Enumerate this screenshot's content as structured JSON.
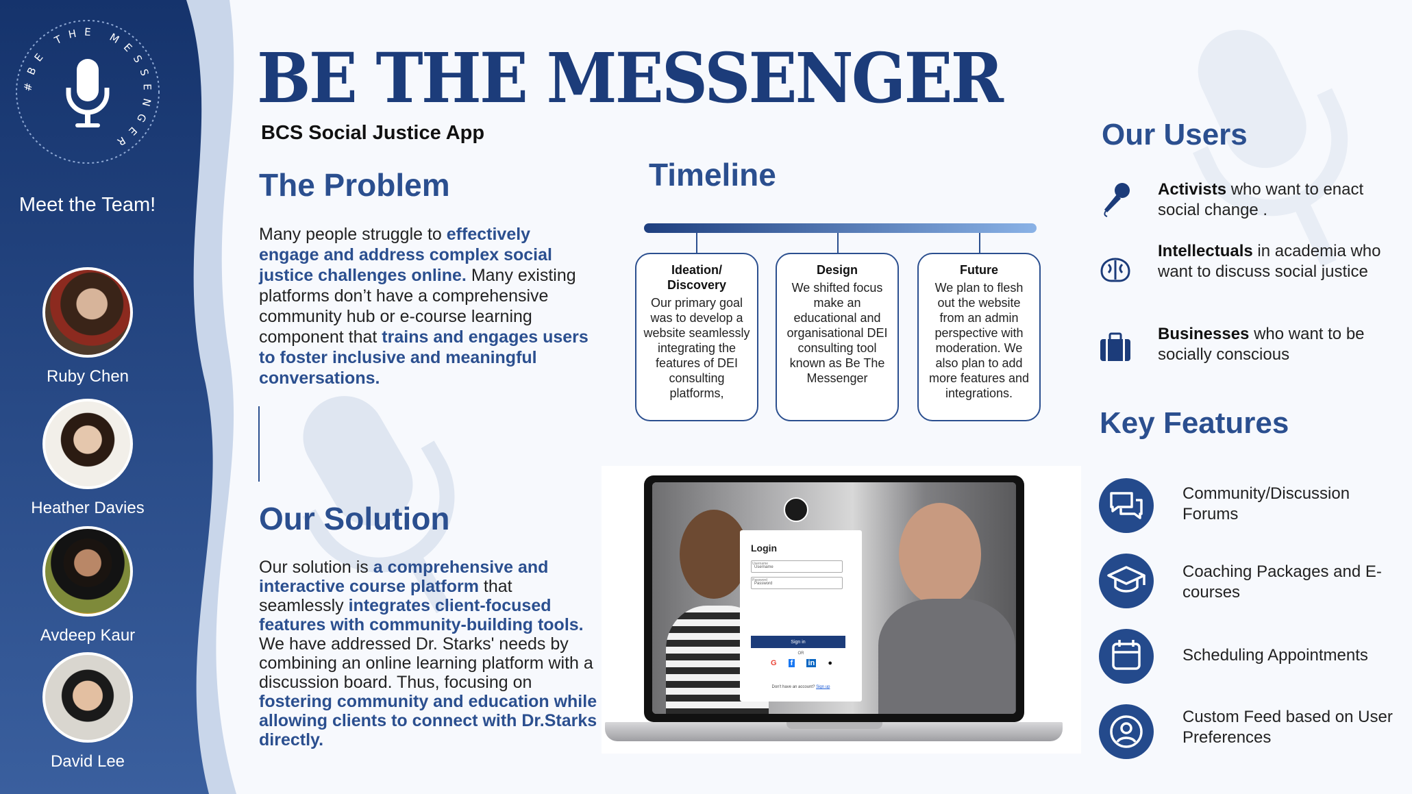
{
  "logo": {
    "ring_text": "#BE THE MESSENGER"
  },
  "team": {
    "heading": "Meet the Team!",
    "members": [
      {
        "name": "Ruby Chen"
      },
      {
        "name": "Heather Davies"
      },
      {
        "name": "Avdeep Kaur"
      },
      {
        "name": "David Lee"
      }
    ]
  },
  "header": {
    "title": "BE THE MESSENGER",
    "subtitle": "BCS Social Justice App"
  },
  "problem": {
    "heading": "The Problem",
    "parts": [
      "Many people struggle to ",
      "effectively engage and address complex social justice challenges online.",
      " Many existing platforms don’t have a comprehensive community hub or e-course learning component that ",
      "trains and engages users to foster inclusive and meaningful conversations."
    ]
  },
  "solution": {
    "heading": "Our Solution",
    "parts": [
      "Our solution is ",
      "a comprehensive and interactive course platform",
      " that seamlessly ",
      "integrates client-focused features with community-building tools.",
      " We have addressed Dr. Starks' needs by combining an online learning platform with a discussion board. Thus, focusing on ",
      "fostering community and education while allowing clients to connect with Dr.Starks directly."
    ]
  },
  "timeline": {
    "heading": "Timeline",
    "stages": [
      {
        "title": "Ideation/ Discovery",
        "text": "Our primary goal was to develop a website seamlessly integrating the features of DEI consulting platforms,"
      },
      {
        "title": "Design",
        "text": "We shifted focus make an educational and organisational DEI consulting tool known as Be The Messenger"
      },
      {
        "title": "Future",
        "text": "We plan to flesh out the website from an admin perspective with moderation. We also plan to add more features and integrations."
      }
    ]
  },
  "mockup": {
    "login_title": "Login",
    "username_label": "Username",
    "username_value": "Username",
    "password_label": "Password",
    "password_value": "Password",
    "signin_label": "Sign in",
    "or_label": "OR",
    "signup_prompt": "Don't have an account?",
    "signup_link": "Sign up",
    "social_icons": [
      "google-icon",
      "facebook-icon",
      "linkedin-icon",
      "apple-icon"
    ]
  },
  "users": {
    "heading": "Our Users",
    "items": [
      {
        "bold": "Activists",
        "text": " who want to enact social change .",
        "icon": "microphone-icon"
      },
      {
        "bold": "Intellectuals",
        "text": " in academia who want to discuss social justice",
        "icon": "brain-icon"
      },
      {
        "bold": "Businesses",
        "text": " who want to be socially conscious",
        "icon": "briefcase-icon"
      }
    ]
  },
  "features": {
    "heading": "Key Features",
    "items": [
      {
        "label": "Community/Discussion Forums",
        "icon": "chat-bubbles-icon"
      },
      {
        "label": "Coaching Packages and E-courses",
        "icon": "graduation-cap-icon"
      },
      {
        "label": "Scheduling Appointments",
        "icon": "calendar-icon"
      },
      {
        "label": "Custom Feed based on User Preferences",
        "icon": "user-profile-icon"
      }
    ]
  },
  "colors": {
    "navy": "#1c3c7a",
    "accent": "#2b4f8f",
    "sidebar": "#1e3f7f"
  }
}
